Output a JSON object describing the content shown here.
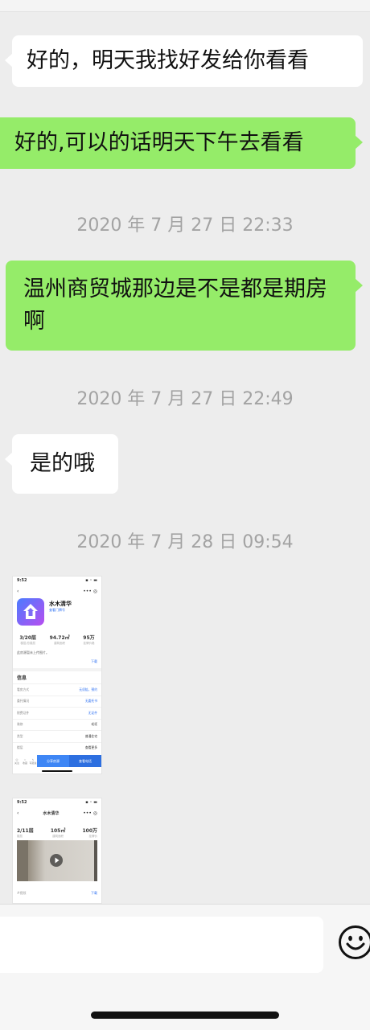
{
  "messages": [
    {
      "side": "left",
      "text": "好的，明天我找好发给你看看"
    },
    {
      "side": "right",
      "text": "好的,可以的话明天下午去看看"
    },
    {
      "side": "right",
      "text": "温州商贸城那边是不是都是期房啊"
    },
    {
      "side": "left",
      "text": "是的哦"
    }
  ],
  "timestamps": [
    "2020 年 7 月 27 日 22:33",
    "2020 年 7 月 27 日 22:49",
    "2020 年 7 月 28 日 09:54"
  ],
  "shot1": {
    "time": "9:52",
    "title": "水木清华",
    "subtitle": "查看门牌号",
    "stats": [
      {
        "value": "3/20层",
        "label": "楼层/总楼层"
      },
      {
        "value": "94.72㎡",
        "label": "建筑面积"
      },
      {
        "value": "95万",
        "label": "挂牌价格"
      }
    ],
    "note": "此房源暂未上传图片。",
    "link": "下载",
    "section": "信息",
    "info": [
      {
        "k": "看房方式",
        "v": "无须陪，预约"
      },
      {
        "k": "委托情况",
        "v": "无委托书"
      },
      {
        "k": "税费证件",
        "v": "无证件"
      },
      {
        "k": "装修",
        "v": "毛坯"
      },
      {
        "k": "类型",
        "v": "普通住宅"
      },
      {
        "k": "楼层",
        "v": "查看更多"
      }
    ],
    "icons": [
      "关注",
      "收藏",
      "写跟进"
    ],
    "btn1": "分享房源",
    "btn2": "查看电话"
  },
  "shot2": {
    "time": "9:52",
    "title": "水木清华",
    "stats": [
      {
        "value": "2/11层",
        "label": "楼层"
      },
      {
        "value": "105㎡",
        "label": "建筑面积"
      },
      {
        "value": "100万",
        "label": "挂牌价"
      }
    ],
    "caption": "#视频",
    "link": "下载"
  }
}
